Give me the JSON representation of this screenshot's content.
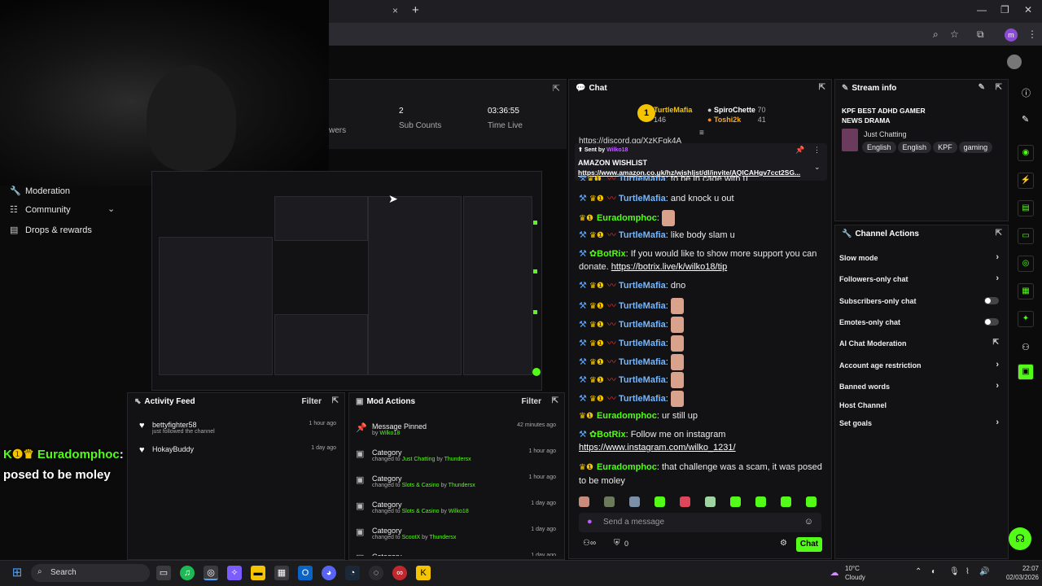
{
  "browser": {
    "new_tab": "+",
    "tab_close": "×",
    "avatar_letter": "m"
  },
  "webcam": {},
  "sidebar": {
    "items": [
      {
        "label": "Moderation",
        "icon": "wrench-icon"
      },
      {
        "label": "Community",
        "icon": "users-icon"
      },
      {
        "label": "Drops & rewards",
        "icon": "gift-icon"
      }
    ]
  },
  "stats": [
    {
      "value": "",
      "label": "wers"
    },
    {
      "value": "2",
      "label": "Sub Counts"
    },
    {
      "value": "03:36:55",
      "label": "Time Live"
    }
  ],
  "overlay_message": {
    "username": "Euradomphoc",
    "text": ": that challenge was a scam, it was posed to be moley"
  },
  "activity_feed": {
    "title": "Activity Feed",
    "filter": "Filter",
    "items": [
      {
        "name": "bettyfighter58",
        "sub": "just followed the channel",
        "time": "1 hour ago"
      },
      {
        "name": "HokayBuddy",
        "sub": "",
        "time": "1 day ago"
      }
    ]
  },
  "mod_actions": {
    "title": "Mod Actions",
    "filter": "Filter",
    "items": [
      {
        "title": "Message Pinned",
        "pre": "by ",
        "target": "",
        "by": "Wilko18",
        "time": "42 minutes ago",
        "icon": "pin-icon"
      },
      {
        "title": "Category",
        "pre": "changed to ",
        "target": "Just Chatting",
        "by": "Thundersx",
        "time": "1 hour ago",
        "icon": "category-icon"
      },
      {
        "title": "Category",
        "pre": "changed to ",
        "target": "Slots & Casino",
        "by": "Thundersx",
        "time": "1 hour ago",
        "icon": "category-icon"
      },
      {
        "title": "Category",
        "pre": "changed to ",
        "target": "Slots & Casino",
        "by": "Wilko18",
        "time": "1 day ago",
        "icon": "category-icon"
      },
      {
        "title": "Category",
        "pre": "changed to ",
        "target": "ScootX",
        "by": "Thundersx",
        "time": "1 day ago",
        "icon": "category-icon"
      },
      {
        "title": "Category",
        "pre": "",
        "target": "",
        "by": "",
        "time": "1 day ago",
        "icon": "category-icon"
      }
    ]
  },
  "chat": {
    "title": "Chat",
    "leaderboard": [
      {
        "name": "TurtleMafia",
        "count": "146"
      },
      {
        "name": "SpiroChette",
        "count": "70"
      },
      {
        "name": "Toshi2k",
        "count": "41"
      }
    ],
    "partial_top": "https://discord.gg/XzKFgk4A",
    "pinned": {
      "sent_by": "Sent by",
      "sender": "Wilko18",
      "title": "AMAZON WISHLIST",
      "link": "https://www.amazon.co.uk/hz/wishlist/dl/invite/AQICAHgv7cct2SG..."
    },
    "messages": [
      {
        "user": "TurtleMafia",
        "text": ": and knock u out",
        "color": "blue",
        "emote": false
      },
      {
        "user": "Euradomphoc",
        "text": ":",
        "color": "green",
        "emote": true
      },
      {
        "user": "TurtleMafia",
        "text": ": like body slam u",
        "color": "blue",
        "emote": false
      },
      {
        "user": "BotRix",
        "text": ": If you would like to show more support you can donate. ",
        "link": "https://botrix.live/k/wilko18/tip",
        "color": "green",
        "emote": false
      },
      {
        "user": "TurtleMafia",
        "text": ": dno",
        "color": "blue",
        "emote": false
      },
      {
        "user": "TurtleMafia",
        "text": ":",
        "color": "blue",
        "emote": true
      },
      {
        "user": "TurtleMafia",
        "text": ":",
        "color": "blue",
        "emote": true
      },
      {
        "user": "TurtleMafia",
        "text": ":",
        "color": "blue",
        "emote": true
      },
      {
        "user": "TurtleMafia",
        "text": ":",
        "color": "blue",
        "emote": true
      },
      {
        "user": "TurtleMafia",
        "text": ":",
        "color": "blue",
        "emote": true
      },
      {
        "user": "TurtleMafia",
        "text": ":",
        "color": "blue",
        "emote": true
      },
      {
        "user": "Euradomphoc",
        "text": ": ur still up",
        "color": "green",
        "emote": false
      },
      {
        "user": "BotRix",
        "text": ": Follow me on instagram ",
        "link": "https://www.instagram.com/wilko_1231/",
        "color": "green",
        "emote": false
      },
      {
        "user": "Euradomphoc",
        "text": ": that challenge was a scam, it was posed to be moley",
        "color": "green",
        "emote": false
      }
    ],
    "send_placeholder": "Send a message",
    "viewers_zero": "0",
    "chat_button": "Chat"
  },
  "stream_info": {
    "title": "Stream info",
    "stream_title": "KPF BEST ADHD GAMER NEWS DRAMA",
    "category": "Just Chatting",
    "tags": [
      "English",
      "English",
      "KPF",
      "gaming"
    ]
  },
  "channel_actions": {
    "title": "Channel Actions",
    "rows": [
      {
        "label": "Slow mode",
        "type": "arrow"
      },
      {
        "label": "Followers-only chat",
        "type": "arrow"
      },
      {
        "label": "Subscribers-only chat",
        "type": "toggle"
      },
      {
        "label": "Emotes-only chat",
        "type": "toggle"
      },
      {
        "label": "AI Chat Moderation",
        "type": "external"
      },
      {
        "label": "Account age restriction",
        "type": "arrow"
      },
      {
        "label": "Banned words",
        "type": "arrow"
      },
      {
        "label": "Host Channel",
        "type": "none"
      },
      {
        "label": "Set goals",
        "type": "arrow"
      }
    ]
  },
  "taskbar": {
    "search": "Search",
    "weather_temp": "10°C",
    "weather_desc": "Cloudy",
    "time": "22:07",
    "date": "02/03/2026"
  },
  "colors": {
    "kick_green": "#53fc18",
    "badge_gold": "#f5c400",
    "user_blue": "#72b7ff"
  }
}
